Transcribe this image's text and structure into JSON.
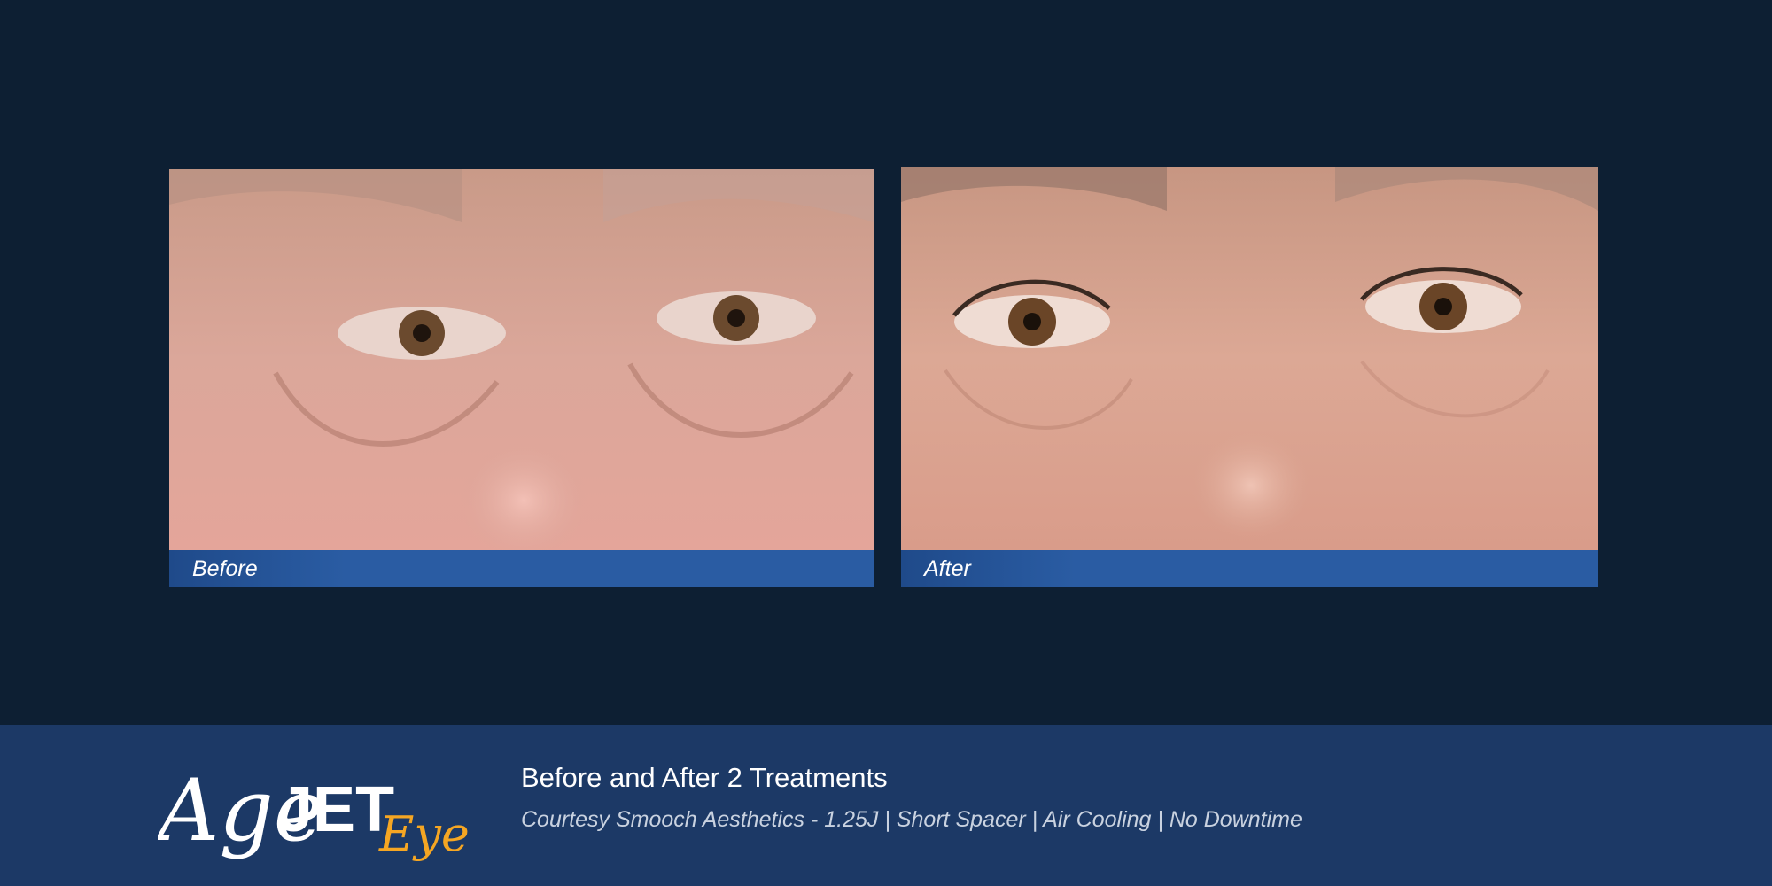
{
  "panels": {
    "before": {
      "label": "Before"
    },
    "after": {
      "label": "After"
    }
  },
  "footer": {
    "title": "Before and After 2 Treatments",
    "subtitle": "Courtesy Smooch Aesthetics -  1.25J  |  Short Spacer  |  Air Cooling  | No Downtime"
  },
  "logo": {
    "text_age": "Age",
    "text_jet": "JET",
    "text_eye": "Eye"
  },
  "colors": {
    "background": "#0d1f33",
    "footer": "#1c3966",
    "caption_bar": "#2a5ca3",
    "accent_orange": "#f5a623"
  }
}
